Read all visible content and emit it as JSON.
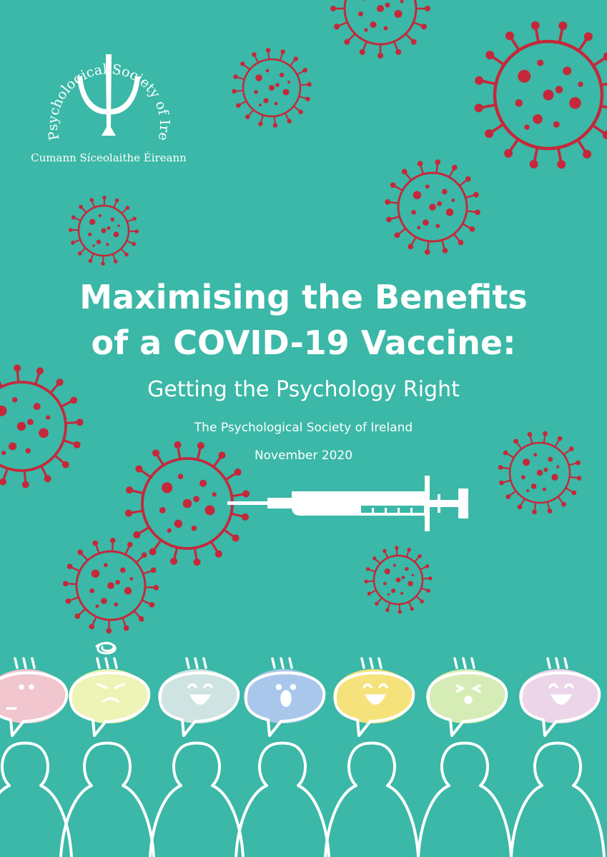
{
  "logo": {
    "name": "The Psychological Society of Ireland",
    "subtitle": "Cumann Síceolaithe Éireann"
  },
  "title": {
    "line1": "Maximising the Benefits",
    "line2": "of a COVID-19 Vaccine:"
  },
  "subtitle": "Getting the Psychology Right",
  "organisation": "The Psychological Society of Ireland",
  "date": "November 2020",
  "colors": {
    "background": "#3bb8a7",
    "virus": "#c5283a",
    "foreground": "#ffffff"
  },
  "speech_bubbles": [
    {
      "color": "#f1c6cf",
      "expression": "neutral"
    },
    {
      "color": "#eef3b6",
      "expression": "frustrated"
    },
    {
      "color": "#cfe4e2",
      "expression": "happy"
    },
    {
      "color": "#a9c7ea",
      "expression": "surprised"
    },
    {
      "color": "#f6e27a",
      "expression": "happy"
    },
    {
      "color": "#d6ecb6",
      "expression": "wink"
    },
    {
      "color": "#ecd5e8",
      "expression": "happy"
    }
  ]
}
